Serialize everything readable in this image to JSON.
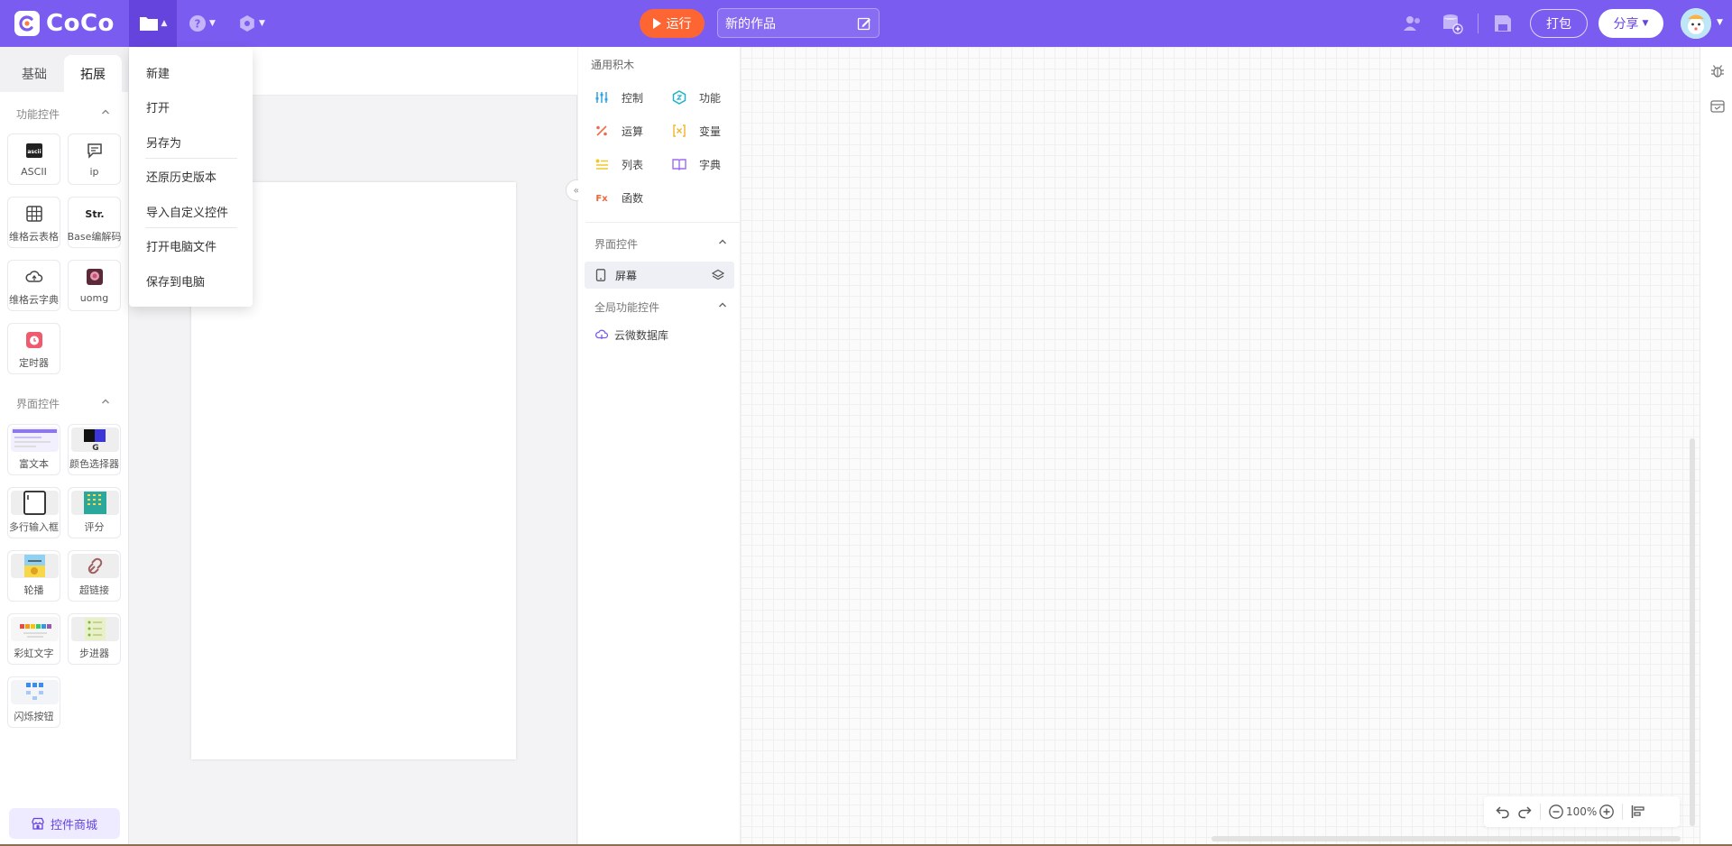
{
  "header": {
    "logo_text": "CoCo",
    "run_label": "运行",
    "title_value": "新的作品",
    "package_label": "打包",
    "share_label": "分享"
  },
  "file_menu": {
    "items": [
      "新建",
      "打开",
      "另存为",
      "还原历史版本",
      "导入自定义控件",
      "打开电脑文件",
      "保存到电脑"
    ]
  },
  "left_panel": {
    "tabs": [
      "基础",
      "拓展"
    ],
    "active_tab": "拓展",
    "function_section": {
      "title": "功能控件",
      "items": [
        {
          "label": "ASCII",
          "icon": "ascii-icon"
        },
        {
          "label": "ip",
          "icon": "chat-icon"
        },
        {
          "label": "维格云表格",
          "icon": "grid-table-icon"
        },
        {
          "label": "Base编解码",
          "icon": "str-icon"
        },
        {
          "label": "维格云字典",
          "icon": "cloud-icon"
        },
        {
          "label": "uomg",
          "icon": "uomg-image-icon"
        },
        {
          "label": "定时器",
          "icon": "alarm-clock-icon"
        }
      ]
    },
    "ui_section": {
      "title": "界面控件",
      "items": [
        {
          "label": "富文本"
        },
        {
          "label": "颜色选择器"
        },
        {
          "label": "多行输入框"
        },
        {
          "label": "评分"
        },
        {
          "label": "轮播"
        },
        {
          "label": "超链接"
        },
        {
          "label": "彩虹文字"
        },
        {
          "label": "步进器"
        },
        {
          "label": "闪烁按钮"
        }
      ]
    },
    "store_label": "控件商城"
  },
  "block_panel": {
    "title": "通用积木",
    "categories": [
      {
        "label": "控制",
        "icon": "control-icon",
        "color": "#2fa3e6"
      },
      {
        "label": "功能",
        "icon": "function-icon",
        "color": "#21b2c8"
      },
      {
        "label": "运算",
        "icon": "operator-icon",
        "color": "#f06b4c"
      },
      {
        "label": "变量",
        "icon": "variable-icon",
        "color": "#f0b52b"
      },
      {
        "label": "列表",
        "icon": "list-icon",
        "color": "#f0c828"
      },
      {
        "label": "字典",
        "icon": "dictionary-icon",
        "color": "#9b6ef0"
      },
      {
        "label": "函数",
        "icon": "fx-icon",
        "color": "#f2663a"
      }
    ],
    "ui_section_title": "界面控件",
    "screen_label": "屏幕",
    "global_section_title": "全局功能控件",
    "cloud_db_label": "云微数据库"
  },
  "workspace": {
    "zoom_level": "100%"
  },
  "colors": {
    "header": "#7b5cf0",
    "run_button": "#fd6633",
    "accent": "#6544dd"
  }
}
